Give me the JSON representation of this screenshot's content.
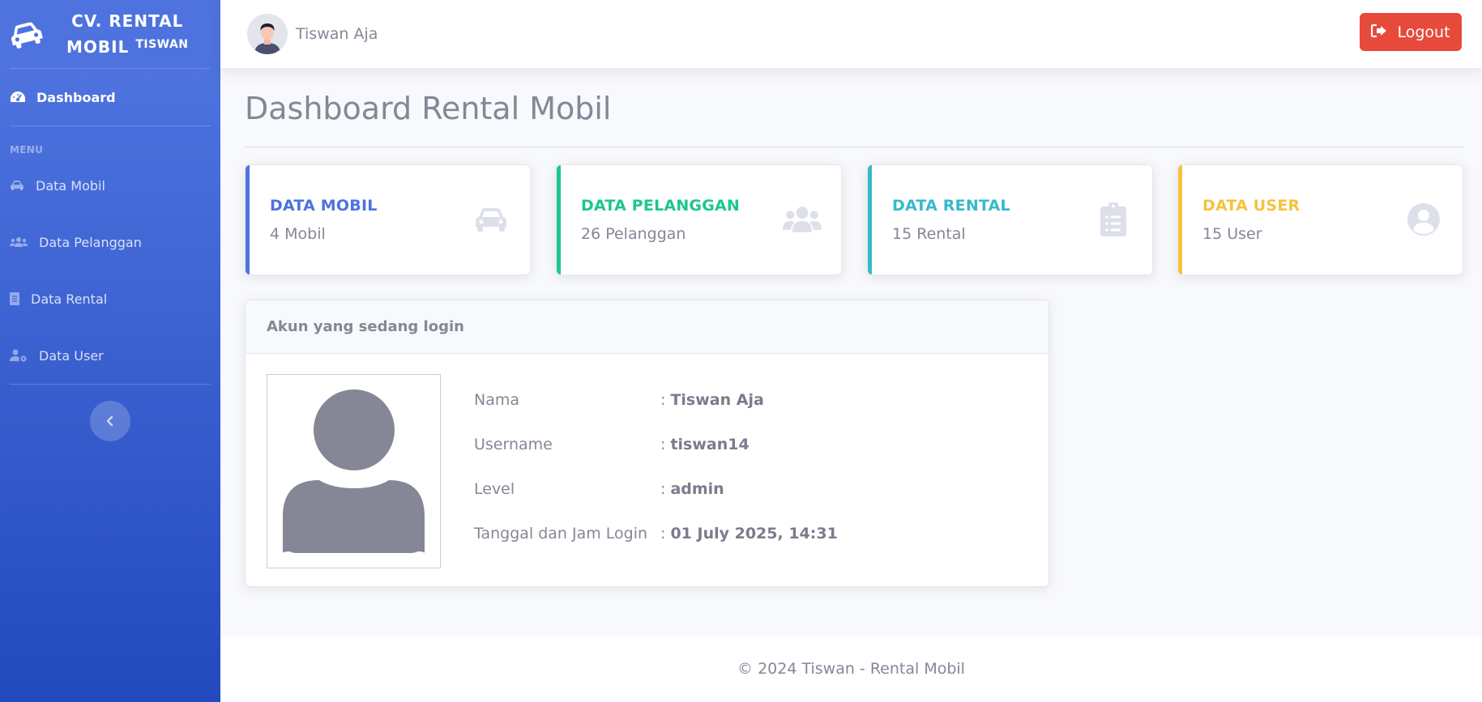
{
  "brand": {
    "line1": "CV. RENTAL",
    "line2": "MOBIL",
    "sup": "TISWAN",
    "icon": "car-side-icon"
  },
  "sidebar": {
    "dashboard": {
      "label": "Dashboard",
      "icon": "tachometer-icon"
    },
    "heading": "MENU",
    "items": [
      {
        "label": "Data Mobil",
        "icon": "car-icon"
      },
      {
        "label": "Data Pelanggan",
        "icon": "users-icon"
      },
      {
        "label": "Data Rental",
        "icon": "file-icon"
      },
      {
        "label": "Data User",
        "icon": "user-cog-icon"
      }
    ],
    "toggle_icon": "chevron-left-icon"
  },
  "topbar": {
    "user_name": "Tiswan Aja",
    "logout_label": "Logout",
    "logout_icon": "sign-out-icon"
  },
  "page": {
    "title": "Dashboard Rental Mobil"
  },
  "stats": [
    {
      "label": "DATA MOBIL",
      "value": "4 Mobil",
      "color": "#4e73df",
      "icon": "car-icon"
    },
    {
      "label": "DATA PELANGGAN",
      "value": "26 Pelanggan",
      "color": "#1cc88a",
      "icon": "users-icon"
    },
    {
      "label": "DATA RENTAL",
      "value": "15 Rental",
      "color": "#36b9cc",
      "icon": "clipboard-list-icon"
    },
    {
      "label": "DATA USER",
      "value": "15 User",
      "color": "#f6c23e",
      "icon": "user-circle-icon"
    }
  ],
  "login_card": {
    "title": "Akun yang sedang login",
    "rows": [
      {
        "key": "Nama",
        "value": "Tiswan Aja"
      },
      {
        "key": "Username",
        "value": "tiswan14"
      },
      {
        "key": "Level",
        "value": "admin"
      },
      {
        "key": "Tanggal dan Jam Login",
        "value": "01 July 2025, 14:31"
      }
    ]
  },
  "footer": {
    "text": "© 2024 Tiswan - Rental Mobil"
  }
}
